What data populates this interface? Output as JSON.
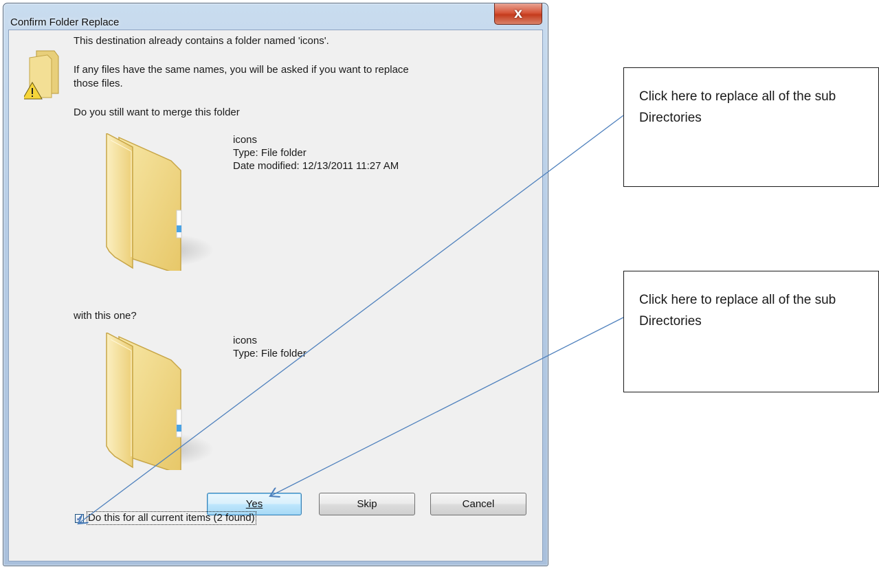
{
  "window": {
    "title": "Confirm Folder Replace",
    "close_label": "X"
  },
  "message": {
    "line1": "This destination already contains a folder named 'icons'.",
    "line2a": "If any files have the same names, you will be asked if you want to replace",
    "line2b": "those files.",
    "question": "Do you still want to merge this folder",
    "with_this": "with this one?"
  },
  "existing_folder": {
    "name": "icons",
    "type": "Type: File folder",
    "modified": "Date modified: 12/13/2011 11:27 AM"
  },
  "incoming_folder": {
    "name": "icons",
    "type": "Type: File folder"
  },
  "buttons": {
    "yes": "Yes",
    "skip": "Skip",
    "cancel": "Cancel"
  },
  "checkbox": {
    "label": "Do this for all current items (2 found)",
    "checked": true
  },
  "annotations": {
    "callout1": "Click here to replace all of the sub Directories",
    "callout2": "Click here to replace all of the sub Directories",
    "arrow_color": "#4f81bd"
  },
  "icons": [
    "folder-warning-icon",
    "folder-icon",
    "close-icon",
    "check-icon"
  ]
}
